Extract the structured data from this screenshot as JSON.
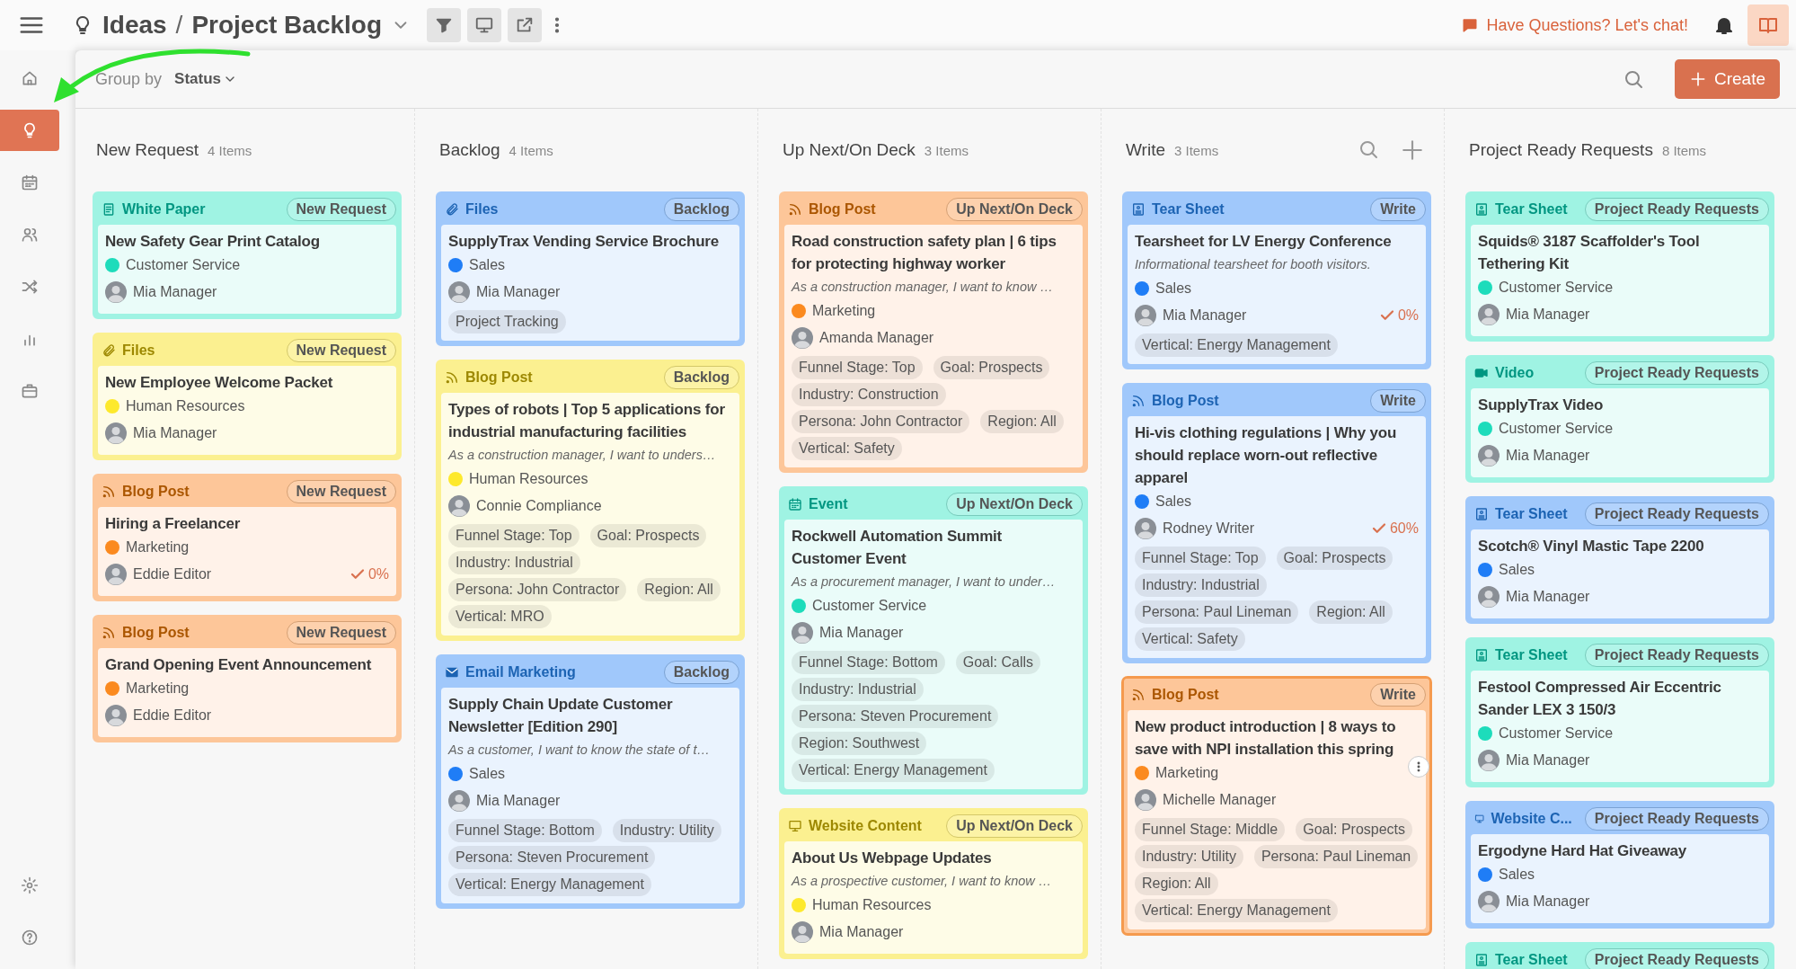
{
  "topbar": {
    "section": "Ideas",
    "separator": "/",
    "page": "Project Backlog",
    "tools": [
      {
        "kind": "filter"
      },
      {
        "kind": "present"
      },
      {
        "kind": "share"
      }
    ],
    "help_link": "Have Questions? Let's chat!"
  },
  "sidebar": {
    "items": [
      {
        "kind": "home",
        "selected": false
      },
      {
        "kind": "idea",
        "selected": true
      },
      {
        "kind": "calendar",
        "selected": false
      },
      {
        "kind": "people",
        "selected": false
      },
      {
        "kind": "shuffle",
        "selected": false
      },
      {
        "kind": "chart",
        "selected": false
      },
      {
        "kind": "briefcase",
        "selected": false
      }
    ],
    "footer_items": [
      {
        "kind": "settings"
      },
      {
        "kind": "help"
      }
    ]
  },
  "toolbar": {
    "group_by_label": "Group by",
    "group_by_value": "Status",
    "create_button": "Create"
  },
  "columns": [
    {
      "title": "New Request",
      "count": "4 Items",
      "show_tools": false,
      "cards": [
        {
          "kind": "paper",
          "type": "White Paper",
          "status": "New Request",
          "color": "#9ff3e3",
          "hovered": false,
          "title": "New Safety Gear Print Catalog",
          "department": {
            "name": "Customer Service",
            "color": "#1ddcbb"
          },
          "assignee": "Mia Manager"
        },
        {
          "kind": "clip",
          "type": "Files",
          "status": "New Request",
          "color": "#fbf090",
          "hovered": false,
          "title": "New Employee Welcome Packet",
          "department": {
            "name": "Human Resources",
            "color": "#fde92c"
          },
          "assignee": "Mia Manager"
        },
        {
          "kind": "rss",
          "type": "Blog Post",
          "status": "New Request",
          "color": "#fdc699",
          "hovered": false,
          "title": "Hiring a Freelancer",
          "department": {
            "name": "Marketing",
            "color": "#fb8a1f"
          },
          "assignee": "Eddie Editor",
          "progress": "0%"
        },
        {
          "kind": "rss",
          "type": "Blog Post",
          "status": "New Request",
          "color": "#fdc699",
          "hovered": false,
          "title": "Grand Opening Event Announcement",
          "department": {
            "name": "Marketing",
            "color": "#fb8a1f"
          },
          "assignee": "Eddie Editor"
        }
      ]
    },
    {
      "title": "Backlog",
      "count": "4 Items",
      "show_tools": false,
      "cards": [
        {
          "kind": "clip",
          "type": "Files",
          "status": "Backlog",
          "color": "#a0c8fb",
          "hovered": false,
          "title": "SupplyTrax Vending Service Brochure",
          "department": {
            "name": "Sales",
            "color": "#1f7df6"
          },
          "assignee": "Mia Manager",
          "tags": [
            "Project Tracking"
          ]
        },
        {
          "kind": "rss",
          "type": "Blog Post",
          "status": "Backlog",
          "color": "#fbf090",
          "hovered": false,
          "title": "Types of robots | Top 5 applications for industrial manufacturing facilities",
          "description": "As a construction manager, I want to unders…",
          "department": {
            "name": "Human Resources",
            "color": "#fde92c"
          },
          "assignee": "Connie Compliance",
          "tags": [
            "Funnel Stage: Top",
            "Goal: Prospects",
            "Industry: Industrial",
            "Persona: John Contractor",
            "Region: All",
            "Vertical: MRO"
          ]
        },
        {
          "kind": "mail",
          "type": "Email Marketing",
          "status": "Backlog",
          "color": "#a0c8fb",
          "hovered": false,
          "title": "Supply Chain Update Customer Newsletter [Edition 290]",
          "description": "As a customer, I want to know the state of t…",
          "department": {
            "name": "Sales",
            "color": "#1f7df6"
          },
          "assignee": "Mia Manager",
          "tags": [
            "Funnel Stage: Bottom",
            "Industry: Utility",
            "Persona: Steven Procurement",
            "Vertical: Energy Management"
          ]
        }
      ]
    },
    {
      "title": "Up Next/On Deck",
      "count": "3 Items",
      "show_tools": false,
      "cards": [
        {
          "kind": "rss",
          "type": "Blog Post",
          "status": "Up Next/On Deck",
          "color": "#fdc699",
          "hovered": false,
          "title": "Road construction safety plan | 6 tips for protecting highway worker",
          "description": "As a construction manager, I want to know …",
          "department": {
            "name": "Marketing",
            "color": "#fb8a1f"
          },
          "assignee": "Amanda Manager",
          "tags": [
            "Funnel Stage: Top",
            "Goal: Prospects",
            "Industry: Construction",
            "Persona: John Contractor",
            "Region: All",
            "Vertical: Safety"
          ]
        },
        {
          "kind": "calendar",
          "type": "Event",
          "status": "Up Next/On Deck",
          "color": "#9ff3e3",
          "hovered": false,
          "title": "Rockwell Automation Summit Customer Event",
          "description": "As a procurement manager, I want to under…",
          "department": {
            "name": "Customer Service",
            "color": "#1ddcbb"
          },
          "assignee": "Mia Manager",
          "tags": [
            "Funnel Stage: Bottom",
            "Goal: Calls",
            "Industry: Industrial",
            "Persona: Steven Procurement",
            "Region: Southwest",
            "Vertical: Energy Management"
          ]
        },
        {
          "kind": "monitor",
          "type": "Website Content",
          "status": "Up Next/On Deck",
          "color": "#fbf090",
          "hovered": false,
          "title": "About Us Webpage Updates",
          "description": "As a prospective customer, I want to know …",
          "department": {
            "name": "Human Resources",
            "color": "#fde92c"
          },
          "assignee": "Mia Manager"
        }
      ]
    },
    {
      "title": "Write",
      "count": "3 Items",
      "show_tools": true,
      "cards": [
        {
          "kind": "sheet",
          "type": "Tear Sheet",
          "status": "Write",
          "color": "#a0c8fb",
          "hovered": false,
          "title": "Tearsheet for LV Energy Conference",
          "description": "Informational tearsheet for booth visitors.",
          "department": {
            "name": "Sales",
            "color": "#1f7df6"
          },
          "assignee": "Mia Manager",
          "progress": "0%",
          "tags": [
            "Vertical: Energy Management"
          ]
        },
        {
          "kind": "rss",
          "type": "Blog Post",
          "status": "Write",
          "color": "#a0c8fb",
          "hovered": false,
          "title": "Hi-vis clothing regulations | Why you should replace worn-out reflective apparel",
          "department": {
            "name": "Sales",
            "color": "#1f7df6"
          },
          "assignee": "Rodney Writer",
          "progress": "60%",
          "tags": [
            "Funnel Stage: Top",
            "Goal: Prospects",
            "Industry: Industrial",
            "Persona: Paul Lineman",
            "Region: All",
            "Vertical: Safety"
          ]
        },
        {
          "kind": "rss",
          "type": "Blog Post",
          "status": "Write",
          "color": "#fdc699",
          "hovered": true,
          "title": "New product introduction | 8 ways to save with NPI installation this spring",
          "department": {
            "name": "Marketing",
            "color": "#fb8a1f"
          },
          "assignee": "Michelle Manager",
          "tags": [
            "Funnel Stage: Middle",
            "Goal: Prospects",
            "Industry: Utility",
            "Persona: Paul Lineman",
            "Region: All",
            "Vertical: Energy Management"
          ]
        }
      ]
    },
    {
      "title": "Project Ready Requests",
      "count": "8 Items",
      "show_tools": false,
      "cards": [
        {
          "kind": "sheet",
          "type": "Tear Sheet",
          "status": "Project Ready Requests",
          "color": "#9ff3e3",
          "hovered": false,
          "title": "Squids® 3187 Scaffolder's Tool Tethering Kit",
          "department": {
            "name": "Customer Service",
            "color": "#1ddcbb"
          },
          "assignee": "Mia Manager"
        },
        {
          "kind": "video",
          "type": "Video",
          "status": "Project Ready Requests",
          "color": "#9ff3e3",
          "hovered": false,
          "title": "SupplyTrax Video",
          "department": {
            "name": "Customer Service",
            "color": "#1ddcbb"
          },
          "assignee": "Mia Manager"
        },
        {
          "kind": "sheet",
          "type": "Tear Sheet",
          "status": "Project Ready Requests",
          "color": "#a0c8fb",
          "hovered": false,
          "title": "Scotch® Vinyl Mastic Tape 2200",
          "department": {
            "name": "Sales",
            "color": "#1f7df6"
          },
          "assignee": "Mia Manager"
        },
        {
          "kind": "sheet",
          "type": "Tear Sheet",
          "status": "Project Ready Requests",
          "color": "#9ff3e3",
          "hovered": false,
          "title": "Festool Compressed Air Eccentric Sander LEX 3 150/3",
          "department": {
            "name": "Customer Service",
            "color": "#1ddcbb"
          },
          "assignee": "Mia Manager"
        },
        {
          "kind": "monitor",
          "type": "Website C...",
          "status": "Project Ready Requests",
          "color": "#a0c8fb",
          "hovered": false,
          "title": "Ergodyne Hard Hat Giveaway",
          "department": {
            "name": "Sales",
            "color": "#1f7df6"
          },
          "assignee": "Mia Manager"
        },
        {
          "kind": "sheet",
          "type": "Tear Sheet",
          "status": "Project Ready Requests",
          "color": "#9ff3e3",
          "hovered": false
        }
      ]
    }
  ]
}
